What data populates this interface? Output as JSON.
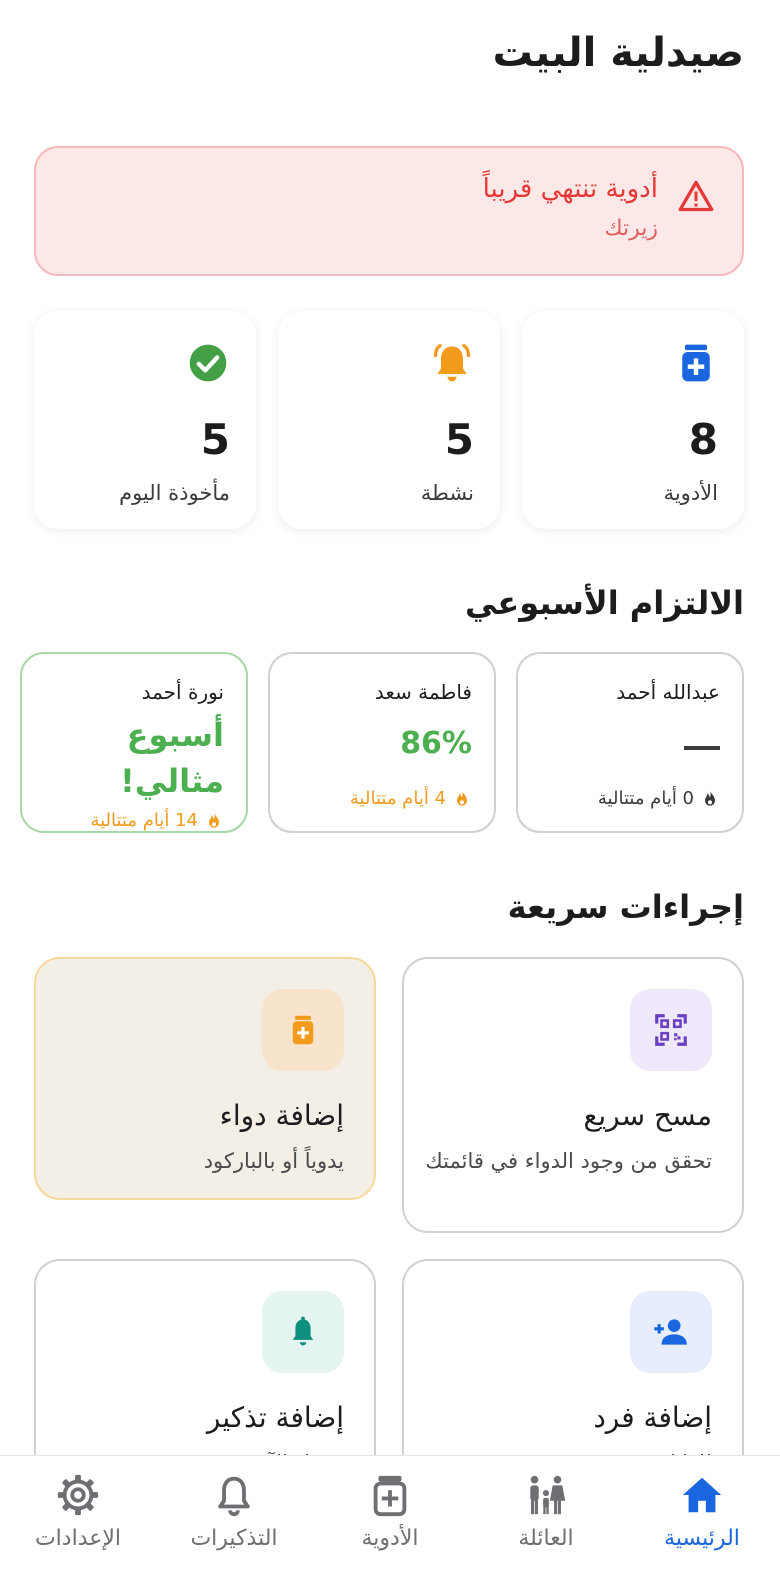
{
  "app": {
    "title": "صيدلية البيت"
  },
  "alert": {
    "title": "أدوية تنتهي قريباً",
    "subtitle": "زيرتك",
    "icon": "warning-triangle-icon",
    "color": "#e53935"
  },
  "stats": [
    {
      "label": "الأدوية",
      "value": "8",
      "icon": "medicine-bottle-icon",
      "color": "#1a66e0"
    },
    {
      "label": "نشطة",
      "value": "5",
      "icon": "bell-icon",
      "color": "#f29b1d"
    },
    {
      "label": "مأخوذة اليوم",
      "value": "5",
      "icon": "check-circle-icon",
      "color": "#43a047"
    }
  ],
  "adherence": {
    "title": "الالتزام الأسبوعي",
    "members": [
      {
        "name": "عبدالله أحمد",
        "value": "—",
        "streak": "0 أيام متتالية"
      },
      {
        "name": "فاطمة سعد",
        "value": "86%",
        "streak": "4 أيام متتالية"
      },
      {
        "name": "نورة أحمد",
        "value_line1": "أسبوع",
        "value_line2": "مثالي!",
        "streak": "14 أيام متتالية"
      }
    ]
  },
  "quick_actions": {
    "title": "إجراءات سريعة",
    "items": [
      {
        "title": "مسح سريع",
        "subtitle": "تحقق من وجود الدواء في قائمتك",
        "icon": "qr-scan-icon"
      },
      {
        "title": "إضافة دواء",
        "subtitle": "يدوياً أو بالباركود",
        "icon": "medicine-bottle-icon"
      },
      {
        "title": "إضافة فرد",
        "subtitle": "للعائلة",
        "icon": "add-person-icon"
      },
      {
        "title": "إضافة تذكير",
        "subtitle": "جدول الآن",
        "icon": "bell-icon"
      }
    ]
  },
  "nav": {
    "items": [
      {
        "label": "الرئيسية",
        "icon": "home-icon",
        "active": true
      },
      {
        "label": "العائلة",
        "icon": "family-icon",
        "active": false
      },
      {
        "label": "الأدوية",
        "icon": "medicine-bottle-icon",
        "active": false
      },
      {
        "label": "التذكيرات",
        "icon": "bell-icon",
        "active": false
      },
      {
        "label": "الإعدادات",
        "icon": "gear-icon",
        "active": false
      }
    ]
  },
  "colors": {
    "accent": "#1a66e0",
    "success": "#4caf50",
    "warning": "#f29b1d",
    "danger": "#e53935"
  }
}
